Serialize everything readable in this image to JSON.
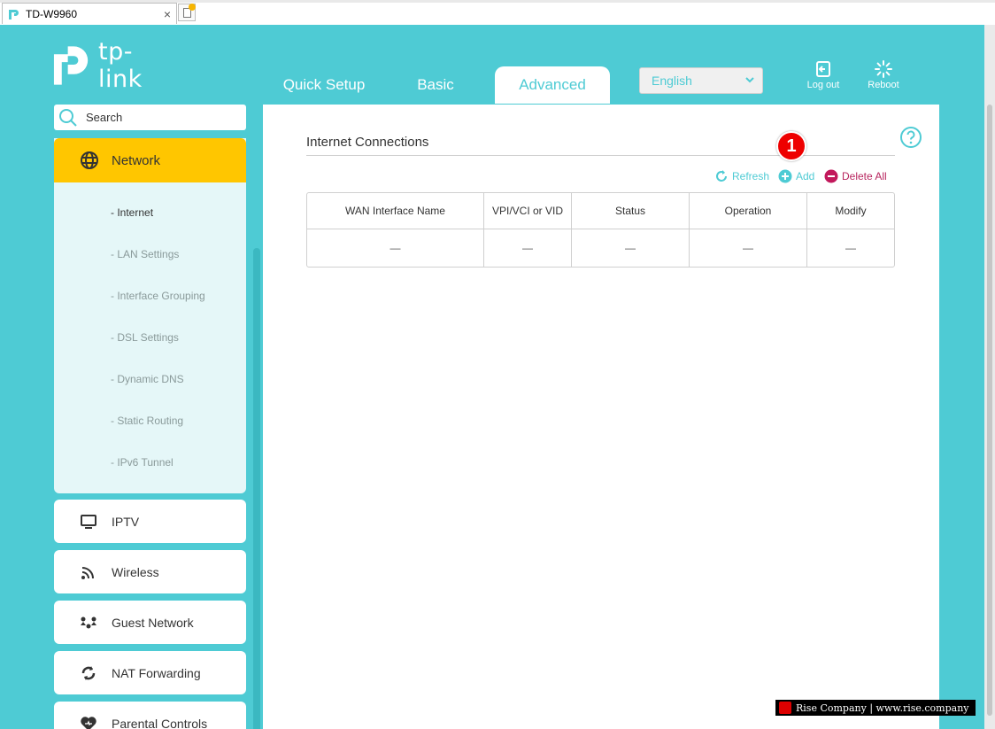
{
  "browser": {
    "tab_title": "TD-W9960",
    "close_glyph": "×"
  },
  "brand": {
    "logo_text": "tp-link",
    "accent_color": "#4ecbd4",
    "highlight_color": "#ffc600"
  },
  "topnav": {
    "tabs": [
      {
        "label": "Quick Setup"
      },
      {
        "label": "Basic"
      },
      {
        "label": "Advanced"
      }
    ],
    "active_tab": "Advanced",
    "language": "English",
    "logout_label": "Log out",
    "reboot_label": "Reboot"
  },
  "sidebar": {
    "search_placeholder": "Search",
    "network": {
      "label": "Network",
      "subitems": [
        {
          "label": "- Internet"
        },
        {
          "label": "- LAN Settings"
        },
        {
          "label": "- Interface Grouping"
        },
        {
          "label": "- DSL Settings"
        },
        {
          "label": "- Dynamic DNS"
        },
        {
          "label": "- Static Routing"
        },
        {
          "label": "- IPv6 Tunnel"
        }
      ],
      "active_subitem": "- Internet"
    },
    "items": [
      {
        "label": "IPTV",
        "icon": "monitor-icon"
      },
      {
        "label": "Wireless",
        "icon": "wifi-icon"
      },
      {
        "label": "Guest Network",
        "icon": "guest-network-icon"
      },
      {
        "label": "NAT Forwarding",
        "icon": "nat-forwarding-icon"
      },
      {
        "label": "Parental Controls",
        "icon": "heart-icon"
      }
    ]
  },
  "main": {
    "section_title": "Internet Connections",
    "annotation_number": "1",
    "actions": {
      "refresh": "Refresh",
      "add": "Add",
      "delete_all": "Delete All"
    },
    "table": {
      "columns": [
        "WAN Interface Name",
        "VPI/VCI or VID",
        "Status",
        "Operation",
        "Modify"
      ],
      "rows": [
        [
          "—",
          "—",
          "—",
          "—",
          "—"
        ]
      ]
    }
  },
  "watermark": {
    "text": "Rise Company | www.rise.company"
  }
}
